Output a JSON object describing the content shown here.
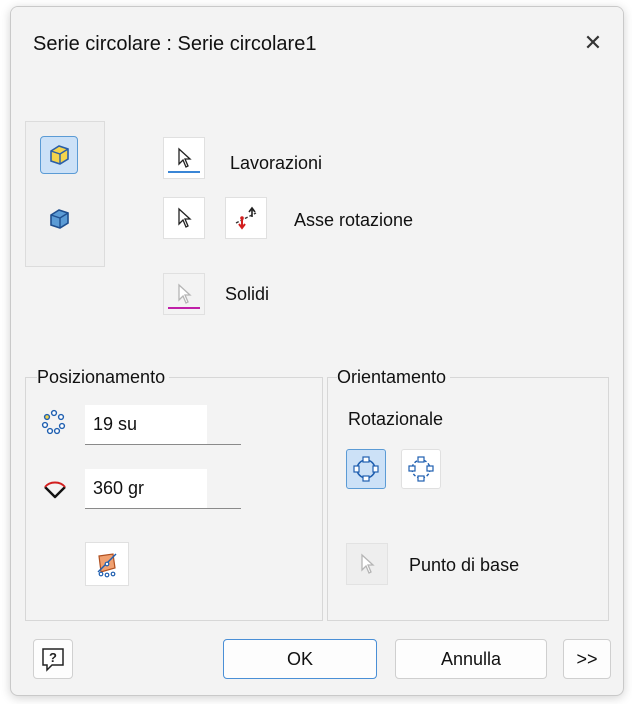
{
  "dialog": {
    "title": "Serie circolare : Serie circolare1",
    "close_glyph": "✕"
  },
  "selection": {
    "features_label": "Lavorazioni",
    "axis_label": "Asse rotazione",
    "solids_label": "Solidi"
  },
  "placement": {
    "group_title": "Posizionamento",
    "count_value": "19 su",
    "angle_value": "360 gr"
  },
  "orientation": {
    "group_title": "Orientamento",
    "mode_label": "Rotazionale",
    "base_point_label": "Punto di base"
  },
  "footer": {
    "help_glyph": "?",
    "ok_label": "OK",
    "cancel_label": "Annulla",
    "more_label": ">>"
  },
  "colors": {
    "features_underline": "#3a86d6",
    "solids_underline": "#c020a8",
    "active_bg": "#cce1f7",
    "active_border": "#5b9bd5"
  }
}
